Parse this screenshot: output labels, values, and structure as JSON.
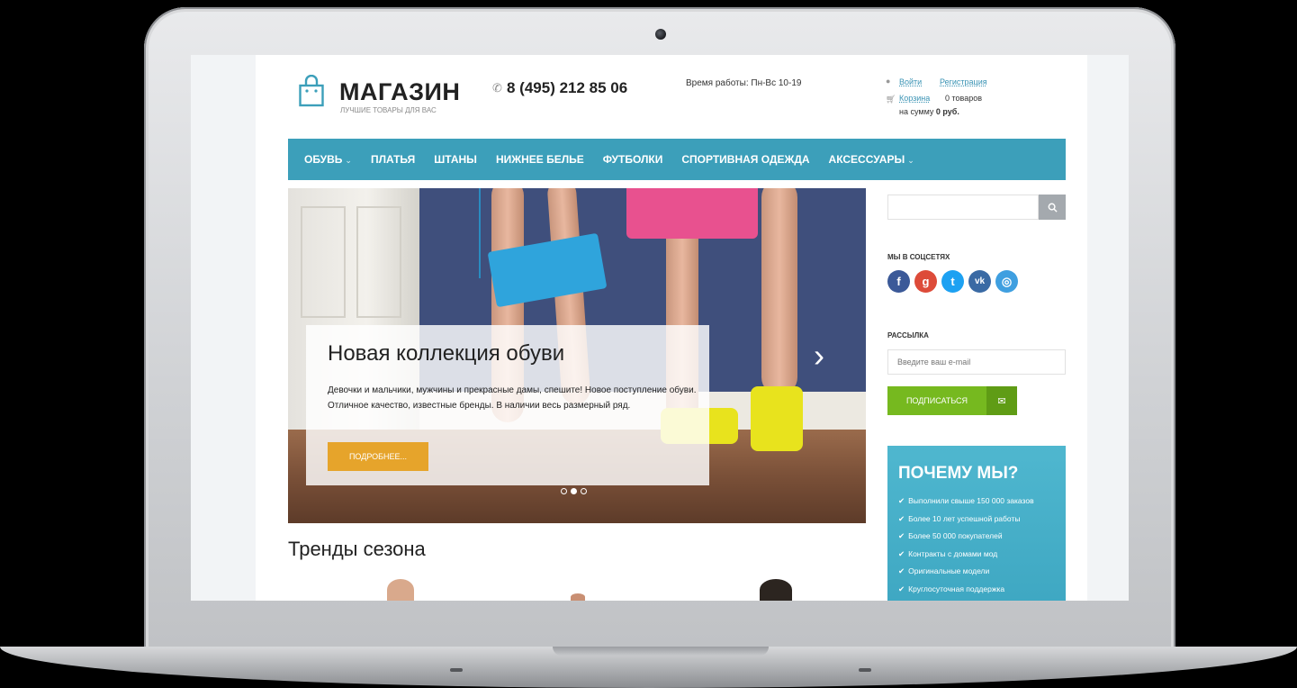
{
  "header": {
    "logo_title": "МАГАЗИН",
    "logo_subtitle": "ЛУЧШИЕ ТОВАРЫ ДЛЯ ВАС",
    "phone": "8 (495) 212 85 06",
    "hours": "Время работы: Пн-Вс 10-19",
    "login": "Войти",
    "register": "Регистрация",
    "cart_link": "Корзина",
    "cart_count": "0 товаров",
    "cart_sum_prefix": "на сумму",
    "cart_sum_value": "0 руб."
  },
  "nav": {
    "items": [
      {
        "label": "ОБУВЬ",
        "dropdown": true
      },
      {
        "label": "ПЛАТЬЯ"
      },
      {
        "label": "ШТАНЫ"
      },
      {
        "label": "НИЖНЕЕ БЕЛЬЕ"
      },
      {
        "label": "ФУТБОЛКИ"
      },
      {
        "label": "СПОРТИВНАЯ ОДЕЖДА"
      },
      {
        "label": "АКСЕССУАРЫ",
        "dropdown": true
      }
    ]
  },
  "slider": {
    "title": "Новая коллекция обуви",
    "text": "Девочки и мальчики, мужчины и прекрасные дамы, спешите! Новое поступление обуви. Отличное качество, известные бренды. В наличии весь размерный ряд.",
    "button": "ПОДРОБНЕЕ...",
    "slide_count": 3,
    "active_slide": 2
  },
  "trends": {
    "title": "Тренды сезона"
  },
  "sidebar": {
    "search_placeholder": "",
    "social_title": "МЫ В СОЦСЕТЯХ",
    "social": [
      {
        "name": "facebook-icon",
        "glyph": "f",
        "color": "#3b5998"
      },
      {
        "name": "google-plus-icon",
        "glyph": "g",
        "color": "#dd4b39"
      },
      {
        "name": "twitter-icon",
        "glyph": "t",
        "color": "#1da1f2"
      },
      {
        "name": "vk-icon",
        "glyph": "vk",
        "color": "#3a6aa4"
      },
      {
        "name": "instagram-icon",
        "glyph": "◎",
        "color": "#3f9fe0"
      }
    ],
    "newsletter_title": "РАССЫЛКА",
    "email_placeholder": "Введите ваш e-mail",
    "subscribe": "ПОДПИСАТЬСЯ",
    "why_title": "ПОЧЕМУ МЫ?",
    "why_items": [
      "Выполнили свыше 150 000 заказов",
      "Более 10 лет успешной работы",
      "Более 50 000 покупателей",
      "Контракты с домами мод",
      "Оригинальные модели",
      "Круглосуточная поддержка"
    ]
  },
  "colors": {
    "nav": "#3c9fba",
    "accent_button": "#e6a42b",
    "subscribe": "#76b91f",
    "why_box": "#4fb7cf"
  }
}
